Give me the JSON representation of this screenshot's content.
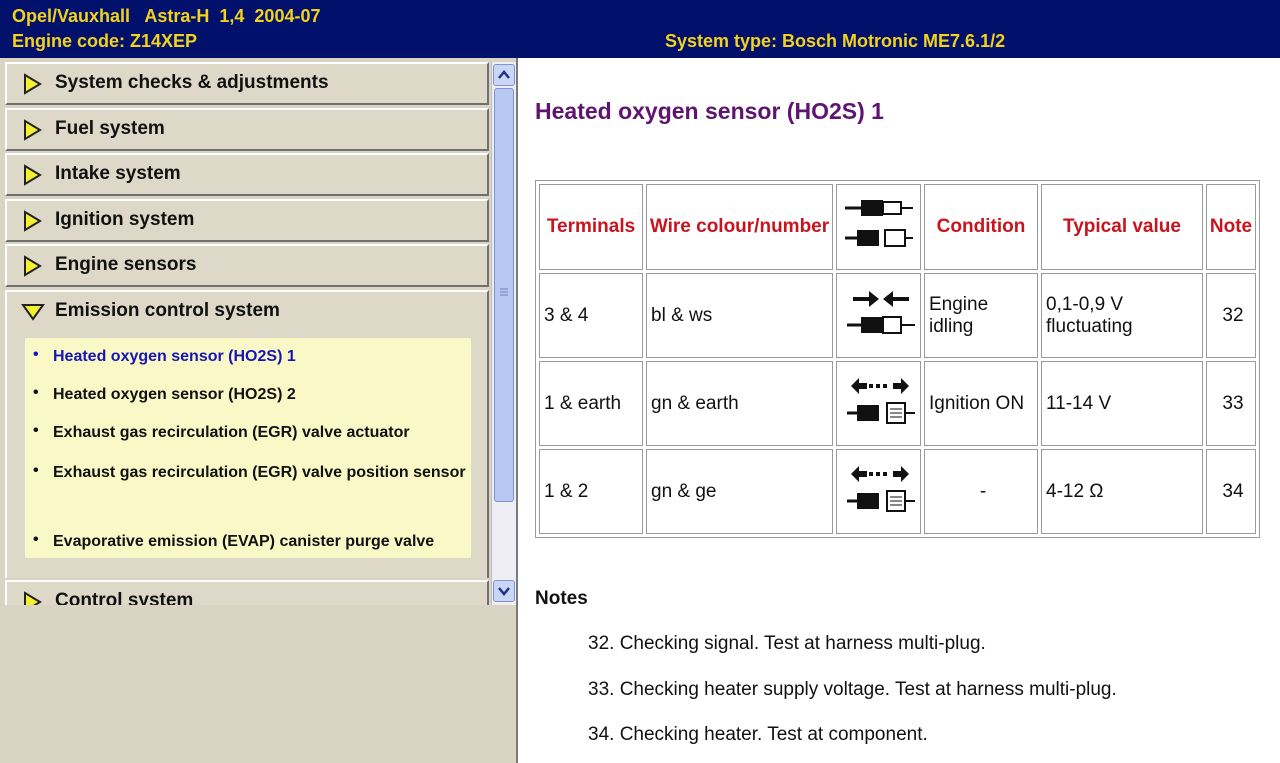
{
  "header": {
    "vehicle": "Opel/Vauxhall   Astra-H  1,4  2004-07",
    "engine_code": "Engine code: Z14XEP",
    "system_type": "System type: Bosch Motronic ME7.6.1/2"
  },
  "nav": {
    "items": [
      {
        "label": "System checks & adjustments"
      },
      {
        "label": "Fuel system"
      },
      {
        "label": "Intake system"
      },
      {
        "label": "Ignition system"
      },
      {
        "label": "Engine sensors"
      }
    ],
    "expanded": {
      "label": "Emission control system",
      "subitems": [
        {
          "label": "Heated oxygen sensor (HO2S) 1"
        },
        {
          "label": "Heated oxygen sensor (HO2S) 2"
        },
        {
          "label": "Exhaust gas recirculation (EGR) valve actuator"
        },
        {
          "label": "Exhaust gas recirculation (EGR) valve position sensor"
        },
        {
          "label": "Evaporative emission (EVAP) canister purge valve"
        }
      ]
    },
    "after": [
      {
        "label": "Control system"
      }
    ]
  },
  "content": {
    "title": "Heated oxygen sensor (HO2S) 1",
    "table": {
      "headers": {
        "terminals": "Terminals",
        "wire": "Wire colour/number",
        "condition": "Condition",
        "typical": "Typical value",
        "note": "Note"
      },
      "rows": [
        {
          "terminals": "3 & 4",
          "wire": "bl & ws",
          "icon": "connected-probe-icon",
          "condition": "Engine idling",
          "typical": "0,1-0,9 V fluctuating",
          "note": "32"
        },
        {
          "terminals": "1 & earth",
          "wire": "gn & earth",
          "icon": "disconnected-probe-icon",
          "condition": "Ignition ON",
          "typical": "11-14 V",
          "note": "33"
        },
        {
          "terminals": "1 & 2",
          "wire": "gn & ge",
          "icon": "disconnected-probe-icon",
          "condition": "-",
          "typical": "4-12 Ω",
          "note": "34"
        }
      ]
    },
    "notes_heading": "Notes",
    "notes": [
      "32. Checking signal. Test at harness multi-plug.",
      "33. Checking heater supply voltage. Test at harness multi-plug.",
      "34. Checking heater. Test at component."
    ]
  },
  "colors": {
    "header_bg": "#00106b",
    "header_text": "#f2d21c",
    "title": "#5e1470",
    "table_header": "#c8141e",
    "active_link": "#1616b4",
    "sublist_bg": "#fbf8c7"
  }
}
